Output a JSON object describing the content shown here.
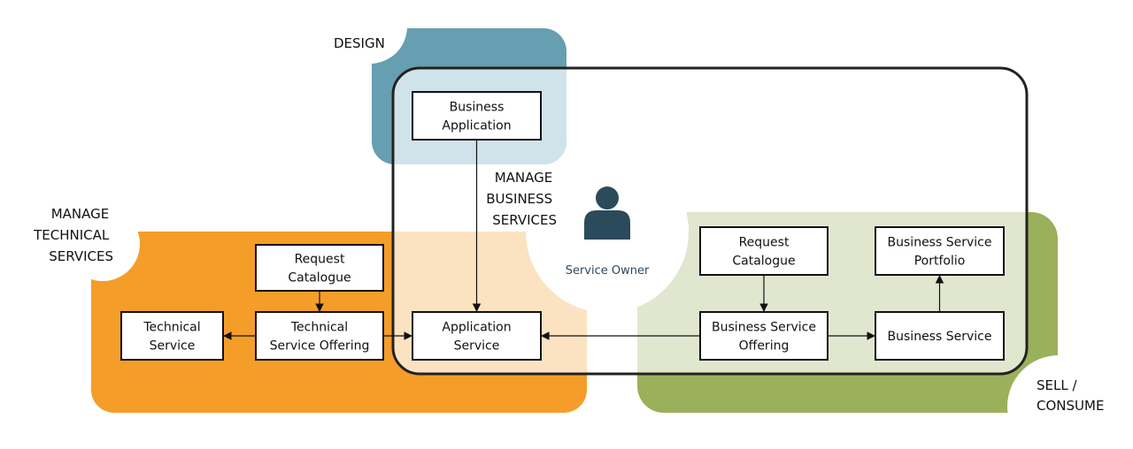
{
  "colors": {
    "design": "#669fb1",
    "design_light": "#d1e3ea",
    "technical": "#f59d29",
    "technical_light": "#fbe3c2",
    "consume": "#9bb05a",
    "consume_light": "#e1e7cf",
    "service_owner": "#2b4a5c"
  },
  "regions": {
    "design": "DESIGN",
    "technical": [
      "MANAGE",
      "TECHNICAL",
      "SERVICES"
    ],
    "business": [
      "MANAGE",
      "BUSINESS",
      "SERVICES"
    ],
    "consume": [
      "SELL /",
      "CONSUME"
    ]
  },
  "service_owner": {
    "label": "Service Owner",
    "icon": "person-icon"
  },
  "nodes": {
    "business_application": [
      "Business",
      "Application"
    ],
    "request_catalogue_tech": [
      "Request",
      "Catalogue"
    ],
    "technical_service": [
      "Technical",
      "Service"
    ],
    "technical_service_offering": [
      "Technical",
      "Service Offering"
    ],
    "application_service": [
      "Application",
      "Service"
    ],
    "request_catalogue_biz": [
      "Request",
      "Catalogue"
    ],
    "business_service_portfolio": [
      "Business Service",
      "Portfolio"
    ],
    "business_service_offering": [
      "Business Service",
      "Offering"
    ],
    "business_service": [
      "Business Service"
    ]
  },
  "edges": [
    [
      "business_application",
      "application_service"
    ],
    [
      "request_catalogue_tech",
      "technical_service_offering"
    ],
    [
      "technical_service_offering",
      "technical_service"
    ],
    [
      "technical_service_offering",
      "application_service"
    ],
    [
      "business_service_offering",
      "application_service"
    ],
    [
      "request_catalogue_biz",
      "business_service_offering"
    ],
    [
      "business_service_offering",
      "business_service"
    ],
    [
      "business_service",
      "business_service_portfolio"
    ]
  ]
}
